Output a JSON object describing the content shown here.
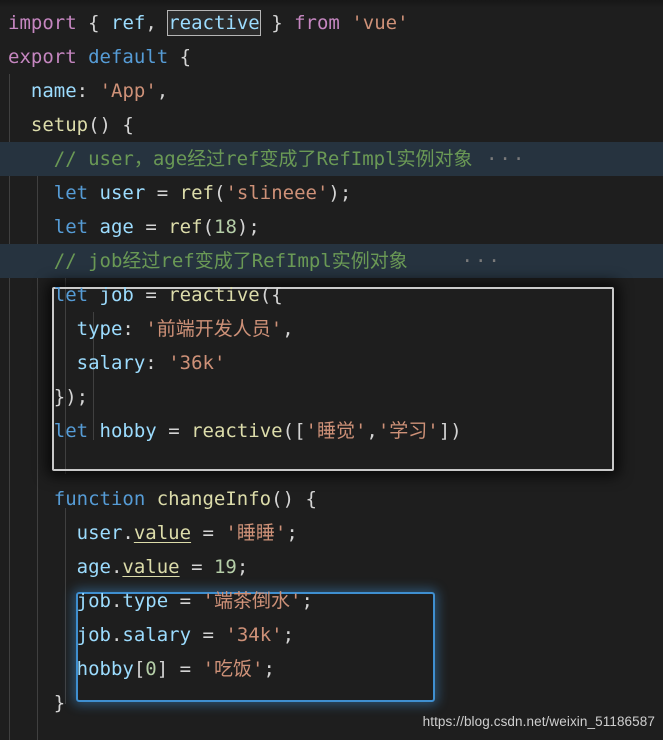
{
  "editor": {
    "theme": "dark-plus",
    "language": "javascript",
    "colors": {
      "background": "#1e1e1e",
      "foreground": "#d4d4d4",
      "keyword": "#c586c0",
      "declaration": "#569cd6",
      "identifier": "#9cdcfe",
      "function": "#dcdcaa",
      "string": "#ce9178",
      "number": "#b5cea8",
      "comment": "#6a9955",
      "line_highlight": "#26333f",
      "selection_outline": "#b5b5b5",
      "callout_white": "#c9c9c9",
      "callout_blue": "#3f8fd0",
      "indent_guide": "#404040",
      "watermark": "#cfcfcf"
    }
  },
  "code": {
    "lines": [
      {
        "id": "l1",
        "indent": 0,
        "highlight": false,
        "tokens": [
          {
            "t": "import",
            "c": "kw-import"
          },
          {
            "t": " ",
            "c": "punc"
          },
          {
            "t": "{",
            "c": "punc"
          },
          {
            "t": " ",
            "c": "punc"
          },
          {
            "t": "ref",
            "c": "ident"
          },
          {
            "t": ",",
            "c": "punc"
          },
          {
            "t": " ",
            "c": "punc"
          },
          {
            "t": "reactive",
            "c": "sel"
          },
          {
            "t": " ",
            "c": "punc"
          },
          {
            "t": "}",
            "c": "punc"
          },
          {
            "t": " ",
            "c": "punc"
          },
          {
            "t": "from",
            "c": "kw-import"
          },
          {
            "t": " ",
            "c": "punc"
          },
          {
            "t": "'vue'",
            "c": "str"
          }
        ]
      },
      {
        "id": "l2",
        "indent": 0,
        "highlight": false,
        "tokens": [
          {
            "t": "export",
            "c": "kw-import"
          },
          {
            "t": " ",
            "c": "punc"
          },
          {
            "t": "default",
            "c": "kw-decl"
          },
          {
            "t": " ",
            "c": "punc"
          },
          {
            "t": "{",
            "c": "punc"
          }
        ]
      },
      {
        "id": "l3",
        "indent": 1,
        "highlight": false,
        "tokens": [
          {
            "t": "  ",
            "c": "punc"
          },
          {
            "t": "name",
            "c": "ident"
          },
          {
            "t": ":",
            "c": "punc"
          },
          {
            "t": " ",
            "c": "punc"
          },
          {
            "t": "'App'",
            "c": "str"
          },
          {
            "t": ",",
            "c": "punc"
          }
        ]
      },
      {
        "id": "l4",
        "indent": 1,
        "highlight": false,
        "tokens": [
          {
            "t": "  ",
            "c": "punc"
          },
          {
            "t": "setup",
            "c": "fn"
          },
          {
            "t": "() {",
            "c": "punc"
          }
        ]
      },
      {
        "id": "l5",
        "indent": 2,
        "highlight": true,
        "tokens": [
          {
            "t": "    ",
            "c": "punc"
          },
          {
            "t": "// user，age经过ref变成了RefImpl实例对象",
            "c": "cmt"
          },
          {
            "t": " ···",
            "c": "ellipsis"
          }
        ]
      },
      {
        "id": "l6",
        "indent": 2,
        "highlight": false,
        "tokens": [
          {
            "t": "    ",
            "c": "punc"
          },
          {
            "t": "let",
            "c": "kw-decl"
          },
          {
            "t": " ",
            "c": "punc"
          },
          {
            "t": "user",
            "c": "ident"
          },
          {
            "t": " ",
            "c": "punc"
          },
          {
            "t": "=",
            "c": "op"
          },
          {
            "t": " ",
            "c": "punc"
          },
          {
            "t": "ref",
            "c": "fn"
          },
          {
            "t": "(",
            "c": "punc"
          },
          {
            "t": "'slineee'",
            "c": "str"
          },
          {
            "t": ");",
            "c": "punc"
          }
        ]
      },
      {
        "id": "l7",
        "indent": 2,
        "highlight": false,
        "tokens": [
          {
            "t": "    ",
            "c": "punc"
          },
          {
            "t": "let",
            "c": "kw-decl"
          },
          {
            "t": " ",
            "c": "punc"
          },
          {
            "t": "age",
            "c": "ident"
          },
          {
            "t": " ",
            "c": "punc"
          },
          {
            "t": "=",
            "c": "op"
          },
          {
            "t": " ",
            "c": "punc"
          },
          {
            "t": "ref",
            "c": "fn"
          },
          {
            "t": "(",
            "c": "punc"
          },
          {
            "t": "18",
            "c": "num"
          },
          {
            "t": ");",
            "c": "punc"
          }
        ]
      },
      {
        "id": "l8",
        "indent": 2,
        "highlight": true,
        "tokens": [
          {
            "t": "    ",
            "c": "punc"
          },
          {
            "t": "// job经过ref变成了RefImpl实例对象",
            "c": "cmt"
          },
          {
            "t": "    ···",
            "c": "ellipsis"
          }
        ]
      },
      {
        "id": "l9",
        "indent": 2,
        "highlight": false,
        "tokens": [
          {
            "t": "    ",
            "c": "punc"
          },
          {
            "t": "let",
            "c": "kw-decl"
          },
          {
            "t": " ",
            "c": "punc"
          },
          {
            "t": "job",
            "c": "ident"
          },
          {
            "t": " ",
            "c": "punc"
          },
          {
            "t": "=",
            "c": "op"
          },
          {
            "t": " ",
            "c": "punc"
          },
          {
            "t": "reactive",
            "c": "fn"
          },
          {
            "t": "({",
            "c": "punc"
          }
        ]
      },
      {
        "id": "l10",
        "indent": 3,
        "highlight": false,
        "tokens": [
          {
            "t": "      ",
            "c": "punc"
          },
          {
            "t": "type",
            "c": "ident"
          },
          {
            "t": ":",
            "c": "punc"
          },
          {
            "t": " ",
            "c": "punc"
          },
          {
            "t": "'前端开发人员'",
            "c": "str"
          },
          {
            "t": ",",
            "c": "punc"
          }
        ]
      },
      {
        "id": "l11",
        "indent": 3,
        "highlight": false,
        "tokens": [
          {
            "t": "      ",
            "c": "punc"
          },
          {
            "t": "salary",
            "c": "ident"
          },
          {
            "t": ":",
            "c": "punc"
          },
          {
            "t": " ",
            "c": "punc"
          },
          {
            "t": "'36k'",
            "c": "str"
          }
        ]
      },
      {
        "id": "l12",
        "indent": 2,
        "highlight": false,
        "tokens": [
          {
            "t": "    ",
            "c": "punc"
          },
          {
            "t": "});",
            "c": "punc"
          }
        ]
      },
      {
        "id": "l13",
        "indent": 2,
        "highlight": false,
        "tokens": [
          {
            "t": "    ",
            "c": "punc"
          },
          {
            "t": "let",
            "c": "kw-decl"
          },
          {
            "t": " ",
            "c": "punc"
          },
          {
            "t": "hobby",
            "c": "ident"
          },
          {
            "t": " ",
            "c": "punc"
          },
          {
            "t": "=",
            "c": "op"
          },
          {
            "t": " ",
            "c": "punc"
          },
          {
            "t": "reactive",
            "c": "fn"
          },
          {
            "t": "([",
            "c": "punc"
          },
          {
            "t": "'睡觉'",
            "c": "str"
          },
          {
            "t": ",",
            "c": "punc"
          },
          {
            "t": "'学习'",
            "c": "str"
          },
          {
            "t": "])",
            "c": "punc"
          }
        ]
      },
      {
        "id": "l14",
        "indent": 2,
        "highlight": false,
        "tokens": []
      },
      {
        "id": "l15",
        "indent": 2,
        "highlight": false,
        "tokens": [
          {
            "t": "    ",
            "c": "punc"
          },
          {
            "t": "function",
            "c": "kw-decl"
          },
          {
            "t": " ",
            "c": "punc"
          },
          {
            "t": "changeInfo",
            "c": "fn"
          },
          {
            "t": "() {",
            "c": "punc"
          }
        ]
      },
      {
        "id": "l16",
        "indent": 3,
        "highlight": false,
        "tokens": [
          {
            "t": "      ",
            "c": "punc"
          },
          {
            "t": "user",
            "c": "ident"
          },
          {
            "t": ".",
            "c": "punc"
          },
          {
            "t": "value",
            "c": "underl"
          },
          {
            "t": " ",
            "c": "punc"
          },
          {
            "t": "=",
            "c": "op"
          },
          {
            "t": " ",
            "c": "punc"
          },
          {
            "t": "'睡睡'",
            "c": "str"
          },
          {
            "t": ";",
            "c": "punc"
          }
        ]
      },
      {
        "id": "l17",
        "indent": 3,
        "highlight": false,
        "tokens": [
          {
            "t": "      ",
            "c": "punc"
          },
          {
            "t": "age",
            "c": "ident"
          },
          {
            "t": ".",
            "c": "punc"
          },
          {
            "t": "value",
            "c": "underl"
          },
          {
            "t": " ",
            "c": "punc"
          },
          {
            "t": "=",
            "c": "op"
          },
          {
            "t": " ",
            "c": "punc"
          },
          {
            "t": "19",
            "c": "num"
          },
          {
            "t": ";",
            "c": "punc"
          }
        ]
      },
      {
        "id": "l18",
        "indent": 3,
        "highlight": false,
        "tokens": [
          {
            "t": "      ",
            "c": "punc"
          },
          {
            "t": "job",
            "c": "ident"
          },
          {
            "t": ".",
            "c": "punc"
          },
          {
            "t": "type",
            "c": "prop"
          },
          {
            "t": " ",
            "c": "punc"
          },
          {
            "t": "=",
            "c": "op"
          },
          {
            "t": " ",
            "c": "punc"
          },
          {
            "t": "'端茶倒水'",
            "c": "str"
          },
          {
            "t": ";",
            "c": "punc"
          }
        ]
      },
      {
        "id": "l19",
        "indent": 3,
        "highlight": false,
        "tokens": [
          {
            "t": "      ",
            "c": "punc"
          },
          {
            "t": "job",
            "c": "ident"
          },
          {
            "t": ".",
            "c": "punc"
          },
          {
            "t": "salary",
            "c": "prop"
          },
          {
            "t": " ",
            "c": "punc"
          },
          {
            "t": "=",
            "c": "op"
          },
          {
            "t": " ",
            "c": "punc"
          },
          {
            "t": "'34k'",
            "c": "str"
          },
          {
            "t": ";",
            "c": "punc"
          }
        ]
      },
      {
        "id": "l20",
        "indent": 3,
        "highlight": false,
        "tokens": [
          {
            "t": "      ",
            "c": "punc"
          },
          {
            "t": "hobby",
            "c": "ident"
          },
          {
            "t": "[",
            "c": "punc"
          },
          {
            "t": "0",
            "c": "num"
          },
          {
            "t": "]",
            "c": "punc"
          },
          {
            "t": " ",
            "c": "punc"
          },
          {
            "t": "=",
            "c": "op"
          },
          {
            "t": " ",
            "c": "punc"
          },
          {
            "t": "'吃饭'",
            "c": "str"
          },
          {
            "t": ";",
            "c": "punc"
          }
        ]
      },
      {
        "id": "l21",
        "indent": 2,
        "highlight": false,
        "tokens": [
          {
            "t": "    ",
            "c": "punc"
          },
          {
            "t": "}",
            "c": "punc"
          }
        ]
      }
    ]
  },
  "annotations": {
    "reactive_box": {
      "label": "reactive-declaration-callout",
      "border_color": "#c9c9c9"
    },
    "mutate_box": {
      "label": "reactive-mutation-callout",
      "border_color": "#3f8fd0"
    },
    "selection": {
      "text": "reactive"
    }
  },
  "watermark": {
    "text": "https://blog.csdn.net/weixin_51186587"
  }
}
